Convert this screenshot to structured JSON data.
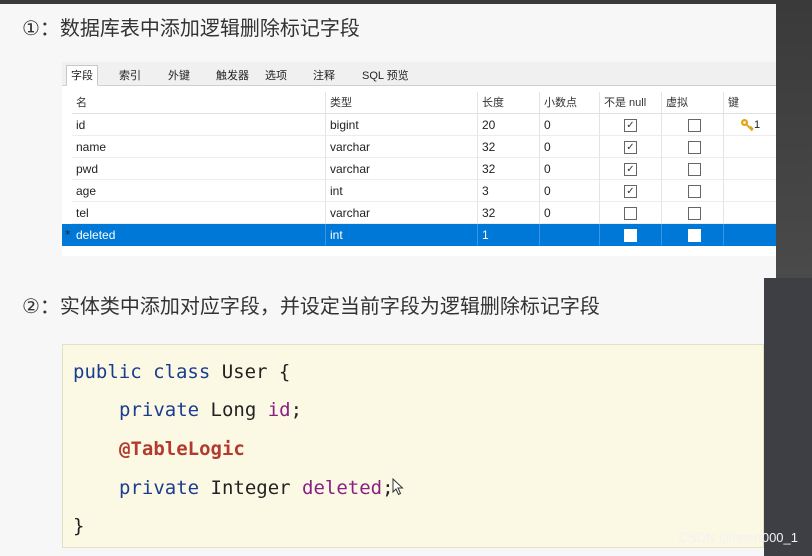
{
  "steps": {
    "step1": "①：数据库表中添加逻辑删除标记字段",
    "step2": "②：实体类中添加对应字段，并设定当前字段为逻辑删除标记字段"
  },
  "designer": {
    "tabs": [
      "字段",
      "索引",
      "外键",
      "触发器",
      "选项",
      "注释",
      "SQL 预览"
    ],
    "active_tab": "字段",
    "columns": [
      "名",
      "类型",
      "长度",
      "小数点",
      "不是 null",
      "虚拟",
      "键"
    ],
    "rows": [
      {
        "name": "id",
        "type": "bigint",
        "length": "20",
        "decimals": "0",
        "not_null": true,
        "virtual": false,
        "key": "1"
      },
      {
        "name": "name",
        "type": "varchar",
        "length": "32",
        "decimals": "0",
        "not_null": true,
        "virtual": false,
        "key": ""
      },
      {
        "name": "pwd",
        "type": "varchar",
        "length": "32",
        "decimals": "0",
        "not_null": true,
        "virtual": false,
        "key": ""
      },
      {
        "name": "age",
        "type": "int",
        "length": "3",
        "decimals": "0",
        "not_null": true,
        "virtual": false,
        "key": ""
      },
      {
        "name": "tel",
        "type": "varchar",
        "length": "32",
        "decimals": "0",
        "not_null": false,
        "virtual": false,
        "key": ""
      },
      {
        "name": "deleted",
        "type": "int",
        "length": "1",
        "decimals": "",
        "not_null": false,
        "virtual": false,
        "key": "",
        "marker": "*",
        "selected": true
      }
    ]
  },
  "code": {
    "line1_kw": "public class",
    "line1_rest": " User {",
    "line2_kw": "private",
    "line2_type": " Long ",
    "line2_field": "id",
    "line2_end": ";",
    "line3": "@TableLogic",
    "line4_kw": "private",
    "line4_type": " Integer ",
    "line4_field": "deleted",
    "line4_end": ";",
    "line5": "}"
  },
  "watermark": "CSDN @heart000_1",
  "colors": {
    "selection": "#0078d7",
    "keyword": "#1a3d8f",
    "field": "#8a1f83",
    "annotation": "#b23a2e",
    "code_bg": "#fbf9e4",
    "key_icon": "#e2a21a"
  },
  "icons": {
    "key": "key-icon",
    "checkbox": "checkbox-icon",
    "cursor": "mouse-cursor-icon"
  }
}
